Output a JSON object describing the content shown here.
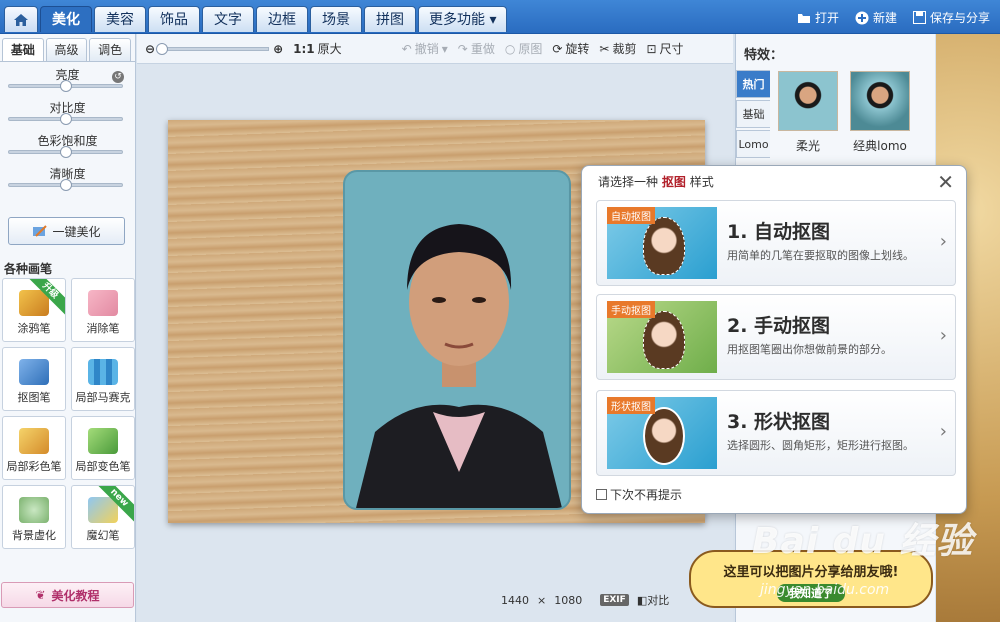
{
  "nav": {
    "tabs": [
      "美化",
      "美容",
      "饰品",
      "文字",
      "边框",
      "场景",
      "拼图",
      "更多功能 ▾"
    ],
    "actions": {
      "open": "打开",
      "new": "新建",
      "save_share": "保存与分享"
    }
  },
  "left": {
    "subtabs": [
      "基础",
      "高级",
      "调色"
    ],
    "sliders": [
      {
        "label": "亮度",
        "value": 0.5
      },
      {
        "label": "对比度",
        "value": 0.5
      },
      {
        "label": "色彩饱和度",
        "value": 0.5
      },
      {
        "label": "清晰度",
        "value": 0.5
      }
    ],
    "one_key": "一键美化",
    "brush_title": "各种画笔",
    "brushes": [
      {
        "label": "涂鸦笔",
        "badge": "升级"
      },
      {
        "label": "消除笔"
      },
      {
        "label": "抠图笔"
      },
      {
        "label": "局部马赛克"
      },
      {
        "label": "局部彩色笔"
      },
      {
        "label": "局部变色笔"
      },
      {
        "label": "背景虚化"
      },
      {
        "label": "魔幻笔",
        "badge": "new"
      }
    ],
    "tutorial": "美化教程"
  },
  "toolbar": {
    "zoom_ratio": "1:1",
    "original_size": "原大",
    "undo": "撤销",
    "redo": "重做",
    "original": "原图",
    "rotate": "旋转",
    "crop": "裁剪",
    "size": "尺寸"
  },
  "status": {
    "width": "1440",
    "x": "×",
    "height": "1080",
    "exif": "EXIF",
    "compare": "对比"
  },
  "right": {
    "title": "特效：",
    "tabs": [
      "热门",
      "基础",
      "Lomo"
    ],
    "effects": [
      "柔光",
      "经典lomo"
    ]
  },
  "dialog": {
    "title_pre": "请选择一种",
    "title_em": "抠图",
    "title_post": "样式",
    "options": [
      {
        "tag": "自动抠图",
        "title": "1. 自动抠图",
        "desc": "用简单的几笔在要抠取的图像上划线。"
      },
      {
        "tag": "手动抠图",
        "title": "2. 手动抠图",
        "desc": "用抠图笔圈出你想做前景的部分。"
      },
      {
        "tag": "形状抠图",
        "title": "3. 形状抠图",
        "desc": "选择圆形、圆角矩形，矩形进行抠图。"
      }
    ],
    "dont_show": "下次不再提示"
  },
  "tip": {
    "text": "这里可以把图片分享给朋友哦!",
    "button": "我知道了"
  },
  "watermark": {
    "brand": "Bai du 经验",
    "url": "jingyan.baidu.com"
  }
}
